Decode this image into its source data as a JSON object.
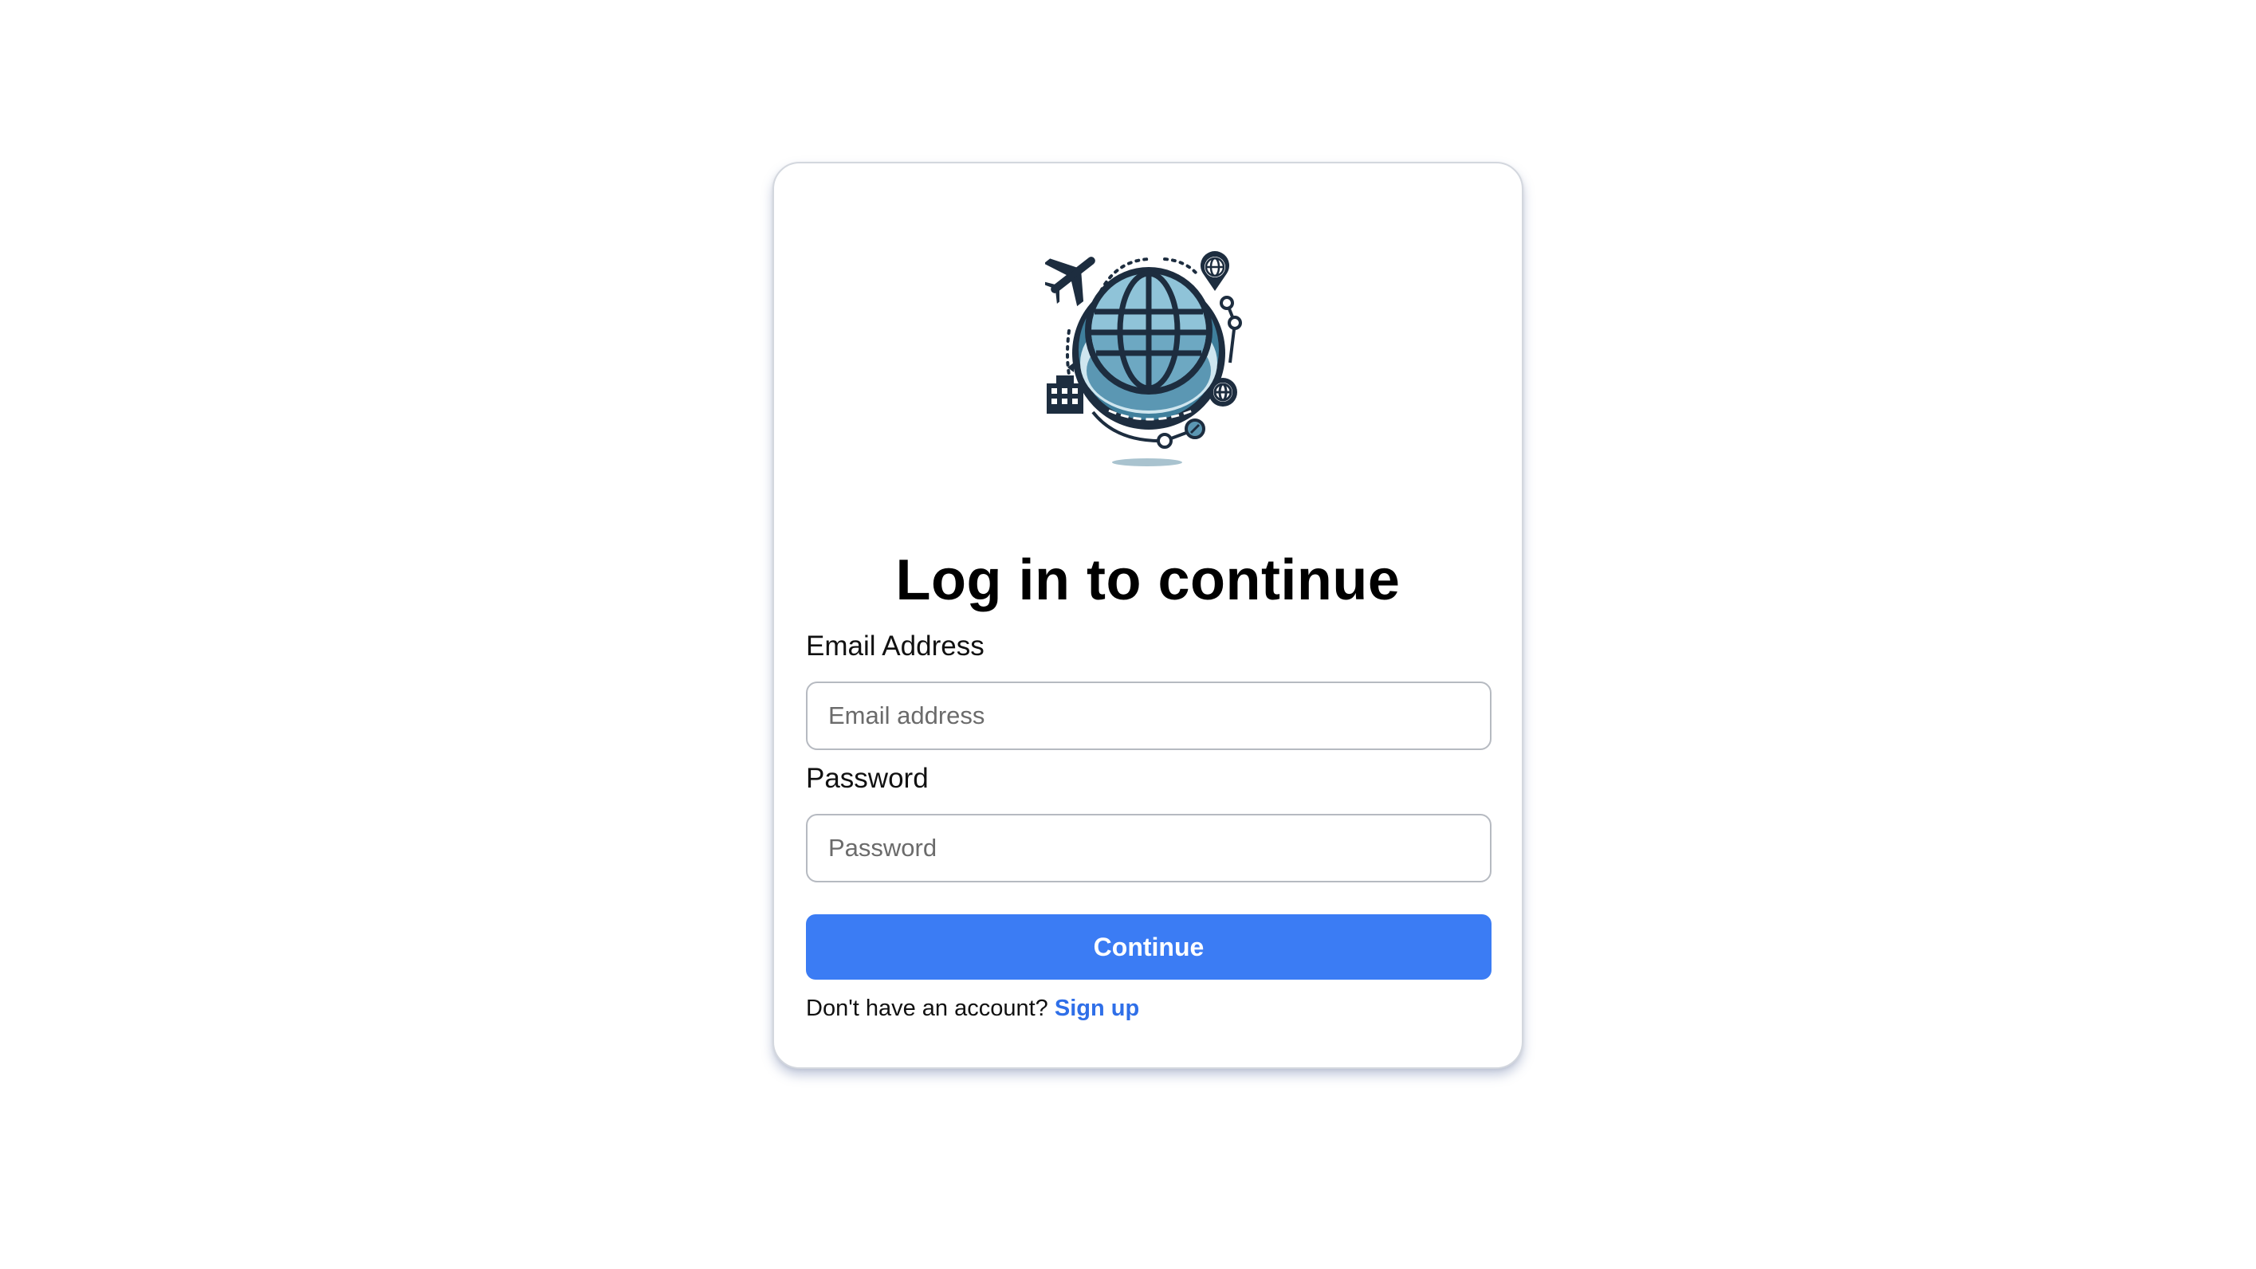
{
  "login": {
    "title": "Log in to continue",
    "email_label": "Email Address",
    "email_placeholder": "Email address",
    "email_value": "",
    "password_label": "Password",
    "password_placeholder": "Password",
    "password_value": "",
    "continue_label": "Continue",
    "signup_prompt": "Don't have an account?",
    "signup_link": "Sign up"
  },
  "logo": {
    "icon": "travel-globe-logo",
    "colors": {
      "dark": "#1d2d3f",
      "globe_light": "#8fc3d8",
      "globe_mid": "#5b97b3",
      "ring": "#cfe6ef",
      "shadow": "#a9c3cf"
    }
  },
  "colors": {
    "accent": "#3b7cf4",
    "link": "#2f6fe8",
    "input_border": "#b6bac1",
    "card_border": "#d3d7de"
  }
}
